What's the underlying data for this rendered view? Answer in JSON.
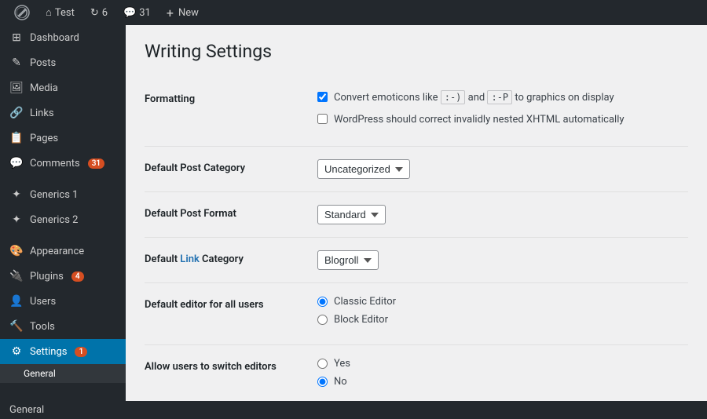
{
  "adminbar": {
    "logo_label": "WordPress",
    "items": [
      {
        "id": "site-name",
        "icon": "home",
        "label": "Test"
      },
      {
        "id": "updates",
        "icon": "refresh",
        "label": "6"
      },
      {
        "id": "comments",
        "icon": "comment",
        "label": "31"
      },
      {
        "id": "new",
        "icon": "plus",
        "label": "New"
      }
    ]
  },
  "sidebar": {
    "items": [
      {
        "id": "dashboard",
        "icon": "⊞",
        "label": "Dashboard",
        "active": false
      },
      {
        "id": "posts",
        "icon": "📄",
        "label": "Posts",
        "active": false
      },
      {
        "id": "media",
        "icon": "🖼",
        "label": "Media",
        "active": false
      },
      {
        "id": "links",
        "icon": "🔗",
        "label": "Links",
        "active": false
      },
      {
        "id": "pages",
        "icon": "📋",
        "label": "Pages",
        "active": false
      },
      {
        "id": "comments",
        "icon": "💬",
        "label": "Comments",
        "badge": "31",
        "active": false
      },
      {
        "id": "generics1",
        "icon": "🔧",
        "label": "Generics 1",
        "active": false
      },
      {
        "id": "generics2",
        "icon": "🔧",
        "label": "Generics 2",
        "active": false
      },
      {
        "id": "appearance",
        "icon": "🎨",
        "label": "Appearance",
        "active": false
      },
      {
        "id": "plugins",
        "icon": "🔌",
        "label": "Plugins",
        "badge": "4",
        "active": false
      },
      {
        "id": "users",
        "icon": "👤",
        "label": "Users",
        "active": false
      },
      {
        "id": "tools",
        "icon": "🔨",
        "label": "Tools",
        "active": false
      },
      {
        "id": "settings",
        "icon": "⚙",
        "label": "Settings",
        "badge": "1",
        "active": true
      }
    ],
    "submenu": [
      {
        "id": "general",
        "label": "General",
        "active": true
      }
    ]
  },
  "page": {
    "title": "Writing Settings"
  },
  "settings": {
    "formatting": {
      "label": "Formatting",
      "option1": {
        "checked": true,
        "text_before": "Convert emoticons like",
        "code1": ":-)",
        "text_middle": "and",
        "code2": ":-P",
        "text_after": "to graphics on display"
      },
      "option2": {
        "checked": false,
        "text": "WordPress should correct invalidly nested XHTML automatically"
      }
    },
    "default_post_category": {
      "label": "Default Post Category",
      "value": "Uncategorized",
      "options": [
        "Uncategorized"
      ]
    },
    "default_post_format": {
      "label": "Default Post Format",
      "value": "Standard",
      "options": [
        "Standard"
      ]
    },
    "default_link_category": {
      "label": "Default Link Category",
      "link_text": "Link",
      "value": "Blogroll",
      "options": [
        "Blogroll"
      ]
    },
    "default_editor": {
      "label": "Default editor for all users",
      "options": [
        {
          "id": "classic",
          "label": "Classic Editor",
          "checked": true
        },
        {
          "id": "block",
          "label": "Block Editor",
          "checked": false
        }
      ]
    },
    "allow_switch": {
      "label": "Allow users to switch editors",
      "options": [
        {
          "id": "yes",
          "label": "Yes",
          "checked": false
        },
        {
          "id": "no",
          "label": "No",
          "checked": true
        }
      ]
    }
  },
  "footer": {
    "breadcrumb": "General"
  }
}
